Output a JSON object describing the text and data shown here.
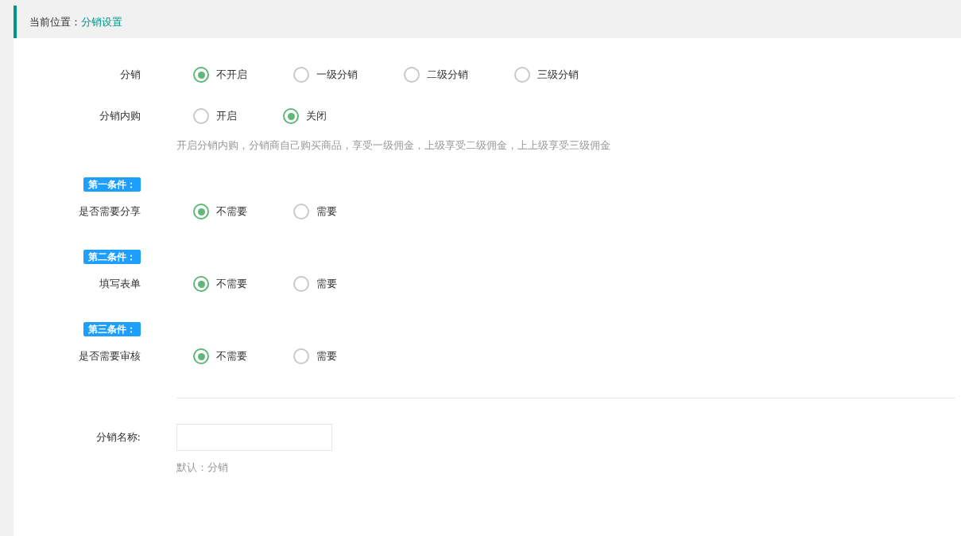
{
  "breadcrumb": {
    "label": "当前位置：",
    "current": "分销设置"
  },
  "items": [
    {
      "kind": "radio",
      "label": "分销",
      "options": [
        {
          "label": "不开启",
          "selected": true
        },
        {
          "label": "一级分销",
          "selected": false
        },
        {
          "label": "二级分销",
          "selected": false
        },
        {
          "label": "三级分销",
          "selected": false
        }
      ]
    },
    {
      "kind": "radio",
      "label": "分销内购",
      "options": [
        {
          "label": "开启",
          "selected": false
        },
        {
          "label": "关闭",
          "selected": true
        }
      ]
    },
    {
      "kind": "hint",
      "text": "开启分销内购，分销商自己购买商品，享受一级佣金，上级享受二级佣金，上上级享受三级佣金"
    },
    {
      "kind": "badge",
      "text": "第一条件："
    },
    {
      "kind": "radio",
      "label": "是否需要分享",
      "options": [
        {
          "label": "不需要",
          "selected": true
        },
        {
          "label": "需要",
          "selected": false
        }
      ]
    },
    {
      "kind": "badge",
      "text": "第二条件："
    },
    {
      "kind": "radio",
      "label": "填写表单",
      "options": [
        {
          "label": "不需要",
          "selected": true
        },
        {
          "label": "需要",
          "selected": false
        }
      ]
    },
    {
      "kind": "badge",
      "text": "第三条件："
    },
    {
      "kind": "radio",
      "label": "是否需要审核",
      "options": [
        {
          "label": "不需要",
          "selected": true
        },
        {
          "label": "需要",
          "selected": false
        }
      ]
    },
    {
      "kind": "divider"
    },
    {
      "kind": "input",
      "label": "分销名称:"
    },
    {
      "kind": "hint",
      "text": "默认：分销"
    }
  ]
}
